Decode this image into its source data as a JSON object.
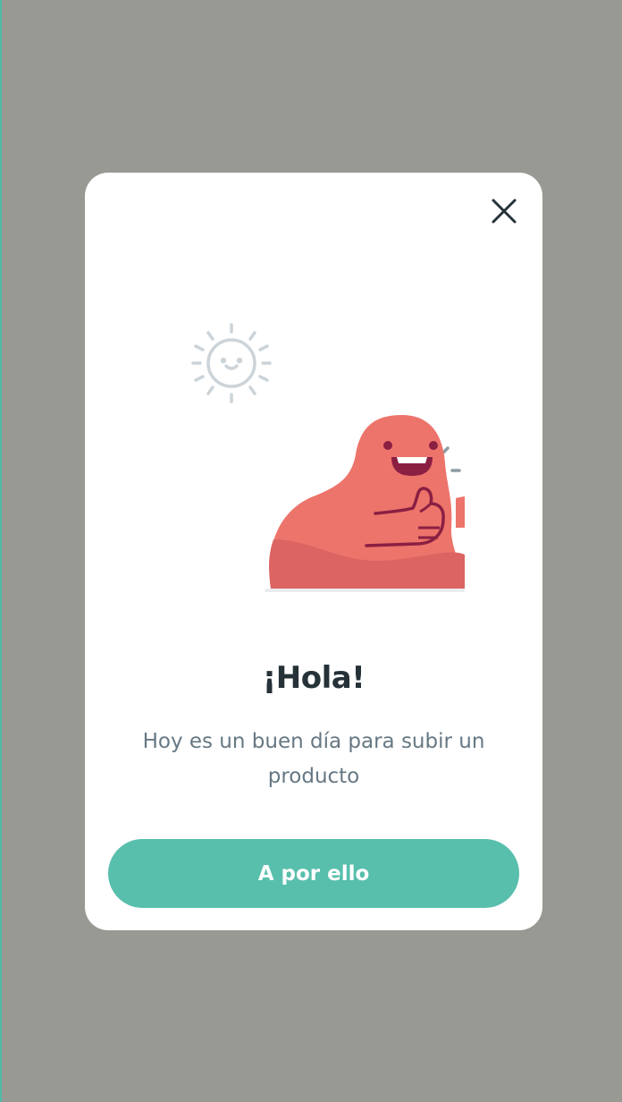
{
  "modal": {
    "title": "¡Hola!",
    "message": "Hoy es un buen día para subir un producto",
    "cta_label": "A por ello",
    "close_icon": "close-icon",
    "illustration": {
      "subject": "smiling pink blob giving thumbs up holding a card",
      "sun_icon": "sun-icon"
    }
  },
  "colors": {
    "overlay": "#999993",
    "modal_bg": "#ffffff",
    "title": "#253238",
    "subtitle": "#667883",
    "cta_bg": "#58bfac",
    "cta_text": "#ffffff",
    "blob": "#ec746b",
    "card": "#99224a"
  }
}
